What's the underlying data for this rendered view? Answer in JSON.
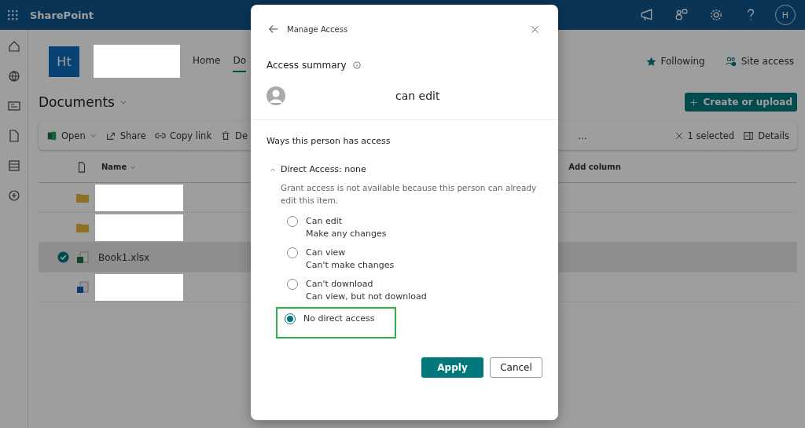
{
  "topbar": {
    "app_name": "SharePoint",
    "avatar": "H"
  },
  "site": {
    "logo": "Ht",
    "nav": [
      {
        "label": "Home",
        "selected": false
      },
      {
        "label": "Do",
        "selected": true
      }
    ],
    "actions": [
      {
        "kind": "star",
        "label": "Following"
      },
      {
        "kind": "people",
        "label": "Site access"
      }
    ]
  },
  "library": {
    "title": "Documents",
    "create_button": "Create or upload"
  },
  "commands": [
    {
      "kind": "excel",
      "label": "Open",
      "caret": true
    },
    {
      "kind": "share",
      "label": "Share",
      "caret": false
    },
    {
      "kind": "link",
      "label": "Copy link",
      "caret": false
    },
    {
      "kind": "trash",
      "label": "De",
      "caret": false
    }
  ],
  "command_more": "...",
  "selection": "1 selected",
  "details": "Details",
  "columns": {
    "name": "Name",
    "add": "Add column"
  },
  "rows": [
    {
      "kind": "folder",
      "name": null,
      "selected": false
    },
    {
      "kind": "folder",
      "name": null,
      "selected": false
    },
    {
      "kind": "excel",
      "name": "Book1.xlsx",
      "selected": true
    },
    {
      "kind": "word",
      "name": null,
      "selected": false
    }
  ],
  "dialog": {
    "title": "Manage Access",
    "summary_label": "Access summary",
    "person_role": "can edit",
    "ways_heading": "Ways this person has access",
    "section": {
      "label": "Direct Access: none",
      "expanded": true
    },
    "note": "Grant access is not available because this person can already edit this item.",
    "options": [
      {
        "label": "Can edit",
        "description": "Make any changes",
        "selected": false,
        "highlighted": false
      },
      {
        "label": "Can view",
        "description": "Can't make changes",
        "selected": false,
        "highlighted": false
      },
      {
        "label": "Can't download",
        "description": "Can view, but not download",
        "selected": false,
        "highlighted": false
      },
      {
        "label": "No direct access",
        "selected": true,
        "highlighted": true
      }
    ],
    "apply": "Apply",
    "cancel": "Cancel"
  }
}
